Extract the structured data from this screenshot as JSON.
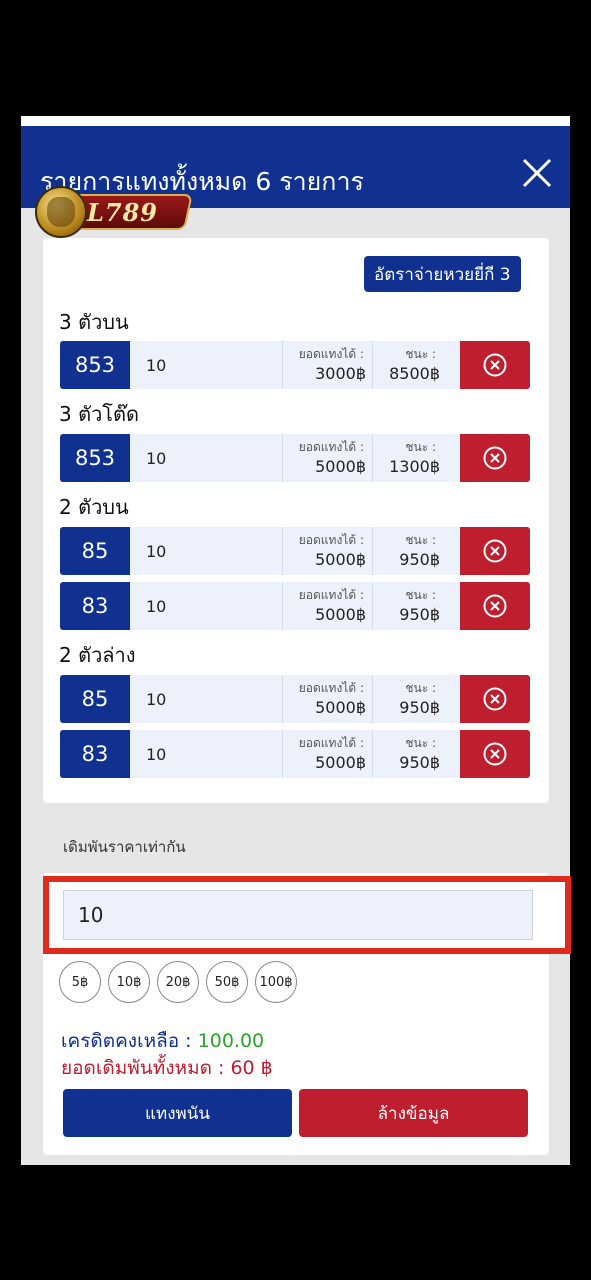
{
  "header": {
    "title": "รายการแทงทั้งหมด 6 รายการ",
    "close_icon": "close-icon"
  },
  "logo": {
    "text": "L789"
  },
  "payout_button": "อัตราจ่ายหวยยี่กี 3",
  "labels": {
    "max_bet": "ยอดแทงได้ :",
    "win": "ชนะ :"
  },
  "groups": [
    {
      "title": "3 ตัวบน"
    },
    {
      "title": "3 ตัวโต๊ด"
    },
    {
      "title": "2 ตัวบน"
    },
    {
      "title": "2 ตัวล่าง"
    }
  ],
  "bets": [
    {
      "number": "853",
      "amount": "10",
      "max_bet": "3000฿",
      "win": "8500฿"
    },
    {
      "number": "853",
      "amount": "10",
      "max_bet": "5000฿",
      "win": "1300฿"
    },
    {
      "number": "85",
      "amount": "10",
      "max_bet": "5000฿",
      "win": "950฿"
    },
    {
      "number": "83",
      "amount": "10",
      "max_bet": "5000฿",
      "win": "950฿"
    },
    {
      "number": "85",
      "amount": "10",
      "max_bet": "5000฿",
      "win": "950฿"
    },
    {
      "number": "83",
      "amount": "10",
      "max_bet": "5000฿",
      "win": "950฿"
    }
  ],
  "same_price_label": "เดิมพันราคาเท่ากัน",
  "same_price_value": "10",
  "chips": [
    "5฿",
    "10฿",
    "20฿",
    "50฿",
    "100฿"
  ],
  "credit": {
    "label": "เครดิตคงเหลือ :",
    "value": "100.00"
  },
  "total": {
    "label": "ยอดเดิมพันทั้งหมด :",
    "value": "60 ฿"
  },
  "buttons": {
    "bet": "แทงพนัน",
    "clear": "ล้างข้อมูล"
  },
  "colors": {
    "primary": "#10318f",
    "danger": "#be1e2d",
    "credit_value": "#2aa52a",
    "highlight_frame": "#e02a1c"
  }
}
